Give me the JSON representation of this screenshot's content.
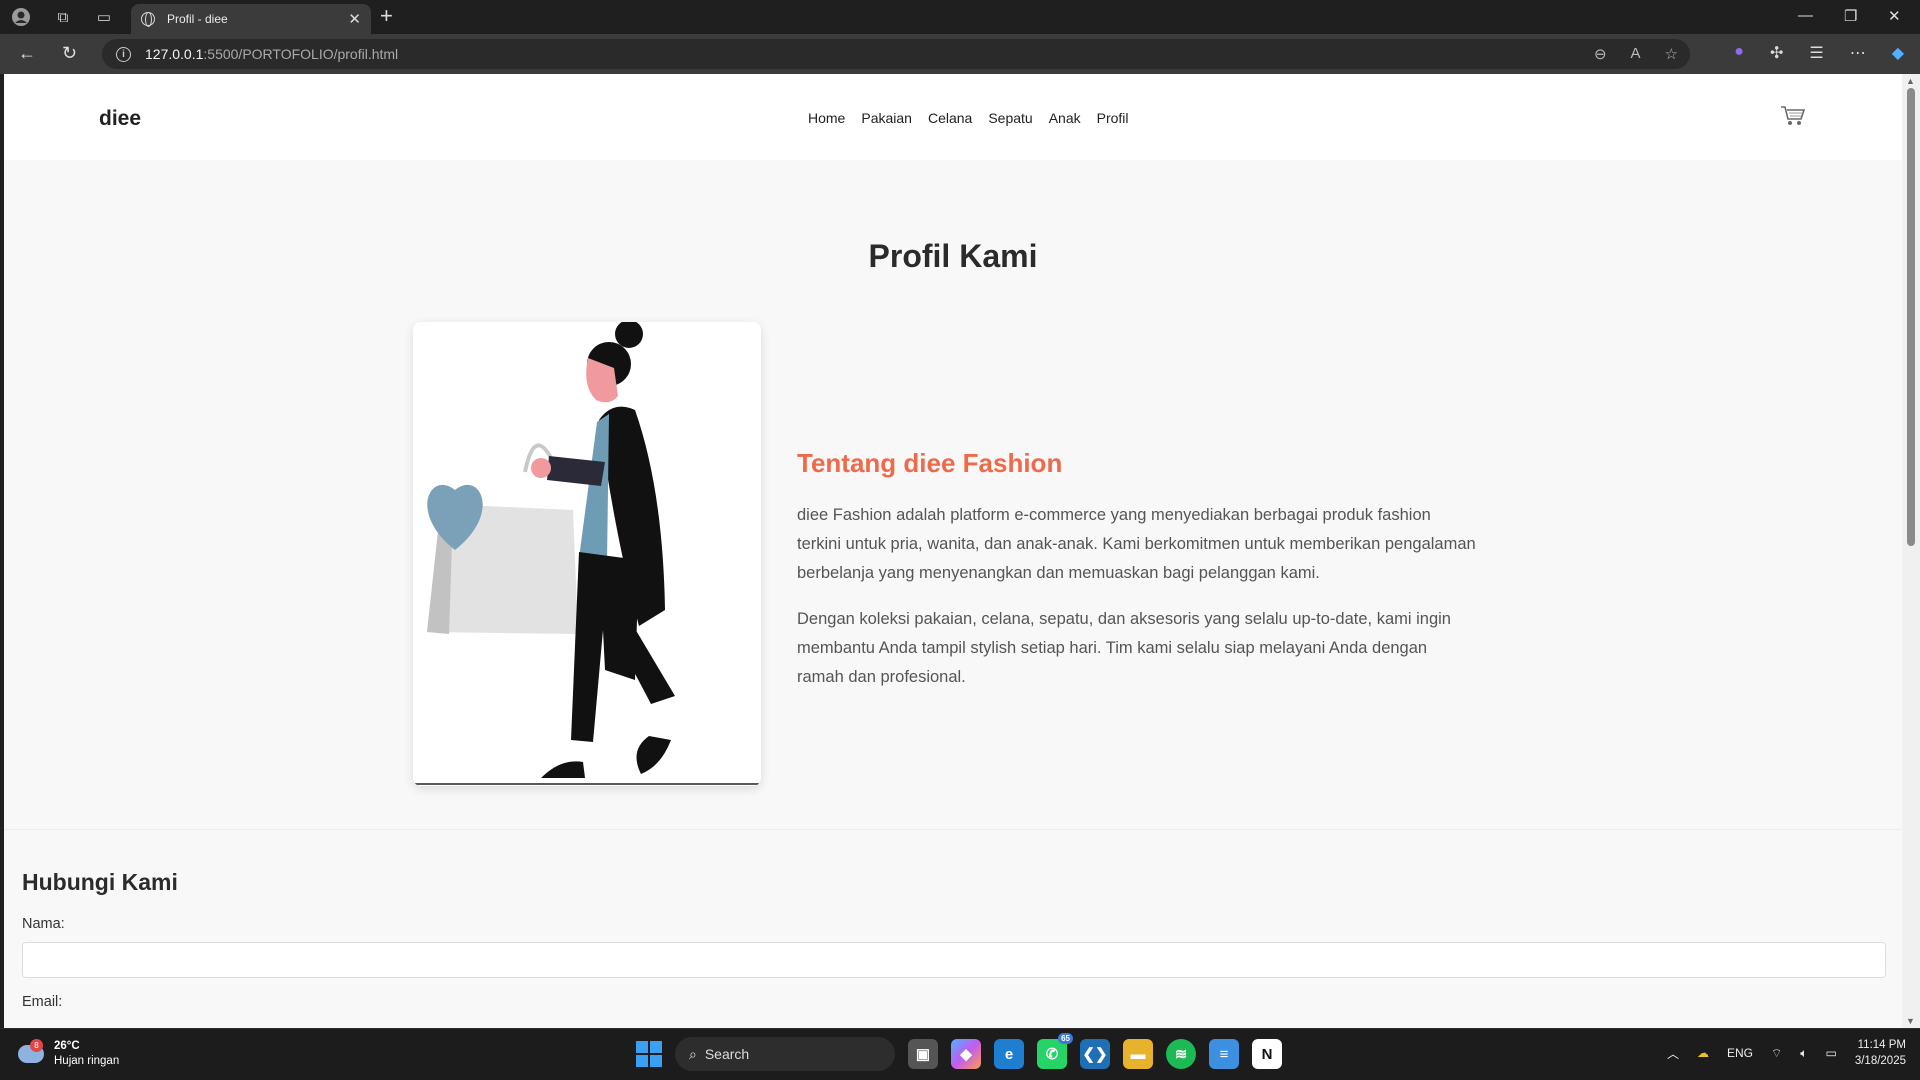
{
  "browser": {
    "tab_title": "Profil - diee",
    "url_host": "127.0.0.1",
    "url_path": ":5500/PORTOFOLIO/profil.html"
  },
  "site": {
    "logo": "diee",
    "nav": [
      "Home",
      "Pakaian",
      "Celana",
      "Sepatu",
      "Anak",
      "Profil"
    ],
    "cart_icon": "cart-icon"
  },
  "profile": {
    "title": "Profil Kami",
    "about_heading": "Tentang diee Fashion",
    "about_p1": "diee Fashion adalah platform e-commerce yang menyediakan berbagai produk fashion terkini untuk pria, wanita, dan anak-anak. Kami berkomitmen untuk memberikan pengalaman berbelanja yang menyenangkan dan memuaskan bagi pelanggan kami.",
    "about_p2": "Dengan koleksi pakaian, celana, sepatu, dan aksesoris yang selalu up-to-date, kami ingin membantu Anda tampil stylish setiap hari. Tim kami selalu siap melayani Anda dengan ramah dan profesional.",
    "accent_color": "#ee6a4a"
  },
  "contact": {
    "title": "Hubungi Kami",
    "name_label": "Nama:",
    "email_label": "Email:"
  },
  "taskbar": {
    "weather_temp": "26°C",
    "weather_desc": "Hujan ringan",
    "weather_badge": "8",
    "search_label": "Search",
    "whatsapp_count": "65",
    "lang": "ENG",
    "time": "11:14 PM",
    "date": "3/18/2025"
  }
}
